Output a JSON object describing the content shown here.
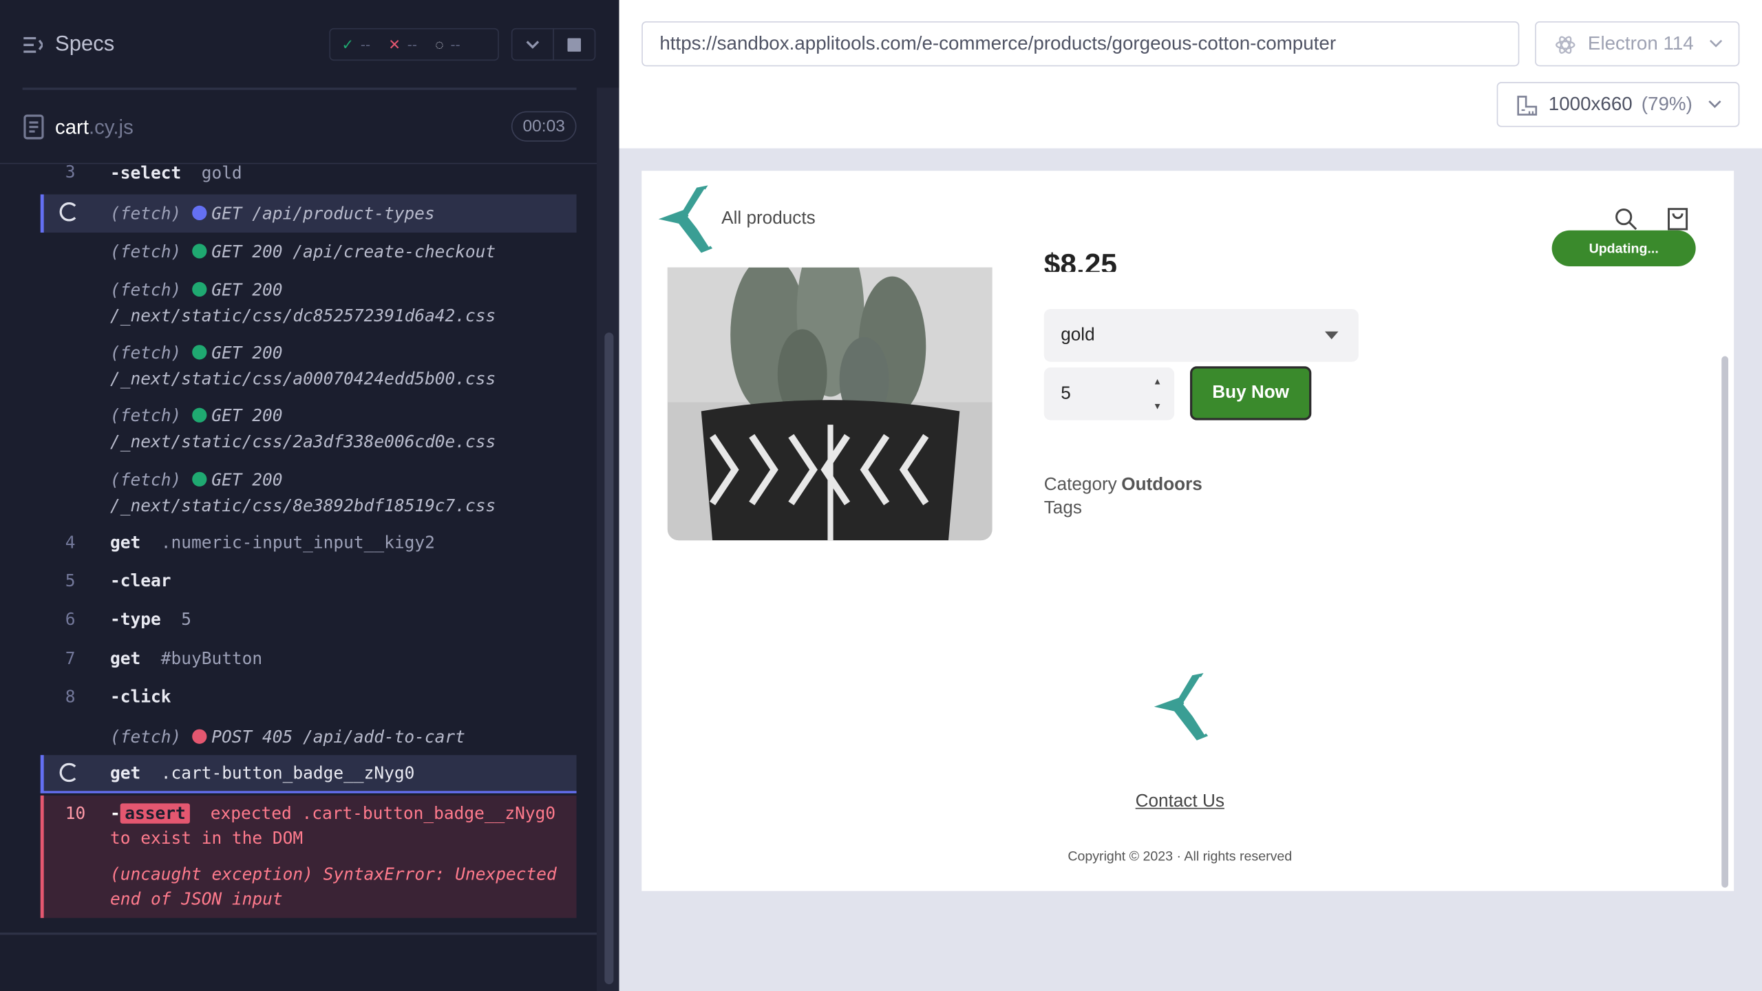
{
  "reporter": {
    "title": "Specs",
    "stats": {
      "passed": "--",
      "failed": "--",
      "pending": "--"
    },
    "file": {
      "name": "cart",
      "ext": ".cy.js"
    },
    "timer": "00:03",
    "commands": [
      {
        "num": "3",
        "cmd": "-select",
        "arg": "gold"
      },
      {
        "prefix": "(fetch)",
        "method": "GET /api/product-types"
      },
      {
        "prefix": "(fetch)",
        "method": "GET 200 /api/create-checkout"
      },
      {
        "prefix": "(fetch)",
        "method": "GET 200",
        "path": "/_next/static/css/dc852572391d6a42.css"
      },
      {
        "prefix": "(fetch)",
        "method": "GET 200",
        "path": "/_next/static/css/a00070424edd5b00.css"
      },
      {
        "prefix": "(fetch)",
        "method": "GET 200",
        "path": "/_next/static/css/2a3df338e006cd0e.css"
      },
      {
        "prefix": "(fetch)",
        "method": "GET 200",
        "path": "/_next/static/css/8e3892bdf18519c7.css"
      },
      {
        "num": "4",
        "cmd": "get",
        "arg": ".numeric-input_input__kigy2"
      },
      {
        "num": "5",
        "cmd": "-clear",
        "arg": ""
      },
      {
        "num": "6",
        "cmd": "-type",
        "arg": "5"
      },
      {
        "num": "7",
        "cmd": "get",
        "arg": "#buyButton"
      },
      {
        "num": "8",
        "cmd": "-click",
        "arg": ""
      },
      {
        "prefix": "(fetch)",
        "method": "POST 405 /api/add-to-cart"
      },
      {
        "cmd": "get",
        "arg": ".cart-button_badge__zNyg0"
      }
    ],
    "error": {
      "num": "10",
      "dash": "-",
      "tag": "assert",
      "line1": "expected .cart-button_badge__zNyg0",
      "line2": "to exist in the DOM",
      "exc1": "(uncaught exception)  SyntaxError: Unexpected",
      "exc2": "end of JSON input"
    }
  },
  "app": {
    "url": "https://sandbox.applitools.com/e-commerce/products/gorgeous-cotton-computer",
    "browser": "Electron 114",
    "viewport": "1000x660",
    "zoom": "(79%)",
    "nav_all_products": "All products",
    "updating": "Updating...",
    "price": "$8.25",
    "select_value": "gold",
    "qty_value": "5",
    "buy_label": "Buy Now",
    "category_label": "Category",
    "category_value": "Outdoors",
    "tags_label": "Tags",
    "contact": "Contact Us",
    "copyright": "Copyright © 2023 · All rights reserved"
  },
  "colors": {
    "accent": "#6470f3",
    "pass": "#1fa971",
    "fail": "#e45770",
    "buy": "#3a8a2c",
    "brand": "#3a9e94"
  }
}
